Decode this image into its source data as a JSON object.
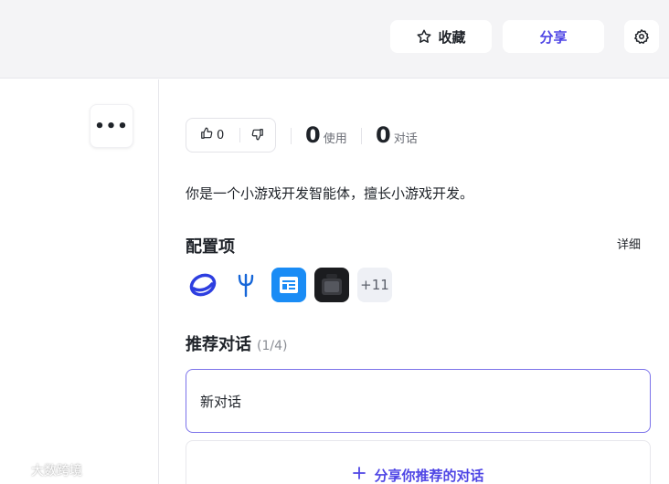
{
  "topbar": {
    "favorite_label": "收藏",
    "share_label": "分享"
  },
  "left": {
    "more_label": "•••",
    "watermark": "大数跨境"
  },
  "agent": {
    "likes": "0",
    "uses_count": "0",
    "uses_label": "使用",
    "chats_count": "0",
    "chats_label": "对话",
    "description": "你是一个小游戏开发智能体，擅长小游戏开发。"
  },
  "config": {
    "title": "配置项",
    "detail_label": "详细",
    "more_tools": "+11",
    "tools": [
      "orbit-logo-icon",
      "fork-logo-icon",
      "news-app-icon",
      "dark-app-icon"
    ]
  },
  "recommend": {
    "title": "推荐对话",
    "count": "(1/4)",
    "items": [
      "新对话"
    ],
    "share_label": "分享你推荐的对话"
  },
  "colors": {
    "accent": "#4f46e5",
    "topbar_bg": "#f4f4f6",
    "border": "#e7e7ec"
  }
}
